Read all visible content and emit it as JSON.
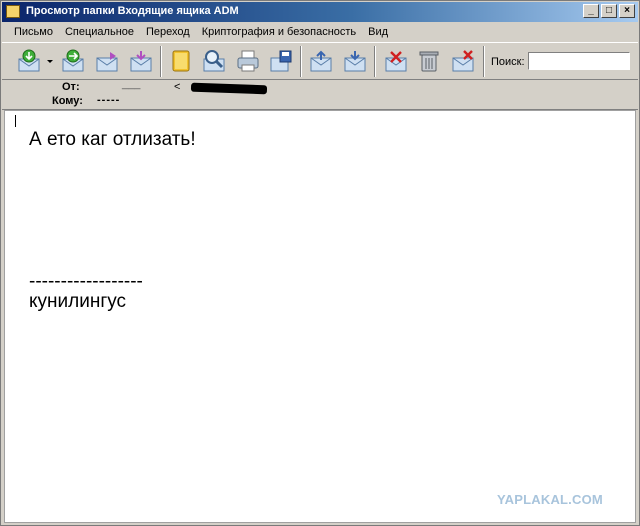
{
  "window": {
    "title": "Просмотр папки Входящие ящика ADM",
    "controls": {
      "minimize": "_",
      "maximize": "□",
      "close": "×"
    }
  },
  "menu": [
    {
      "label": "Письмо"
    },
    {
      "label": "Специальное"
    },
    {
      "label": "Переход"
    },
    {
      "label": "Криптография и безопасность"
    },
    {
      "label": "Вид"
    }
  ],
  "toolbar": {
    "buttons": [
      {
        "name": "receive-mail-icon"
      },
      {
        "name": "forward-mail-icon"
      },
      {
        "name": "reply-mail-icon"
      },
      {
        "name": "new-mail-icon"
      },
      {
        "name": "address-book-icon"
      },
      {
        "name": "find-icon"
      },
      {
        "name": "print-icon"
      },
      {
        "name": "save-icon"
      },
      {
        "name": "previous-mail-icon"
      },
      {
        "name": "next-mail-icon"
      },
      {
        "name": "delete-mail-icon"
      },
      {
        "name": "trash-icon"
      },
      {
        "name": "spam-icon"
      }
    ],
    "search_label": "Поиск:",
    "search_value": ""
  },
  "headers": {
    "from_label": "От:",
    "from_value": "___",
    "from_address": "<",
    "to_label": "Кому:",
    "to_value": "-----"
  },
  "message": {
    "line1": "А ето каг отлизать!",
    "separator": "------------------",
    "signature": "кунилингус"
  },
  "watermark": "YAPLAKAL.COM",
  "colors": {
    "title_start": "#0a246a",
    "title_end": "#a6caf0",
    "chrome": "#d4d0c8"
  }
}
